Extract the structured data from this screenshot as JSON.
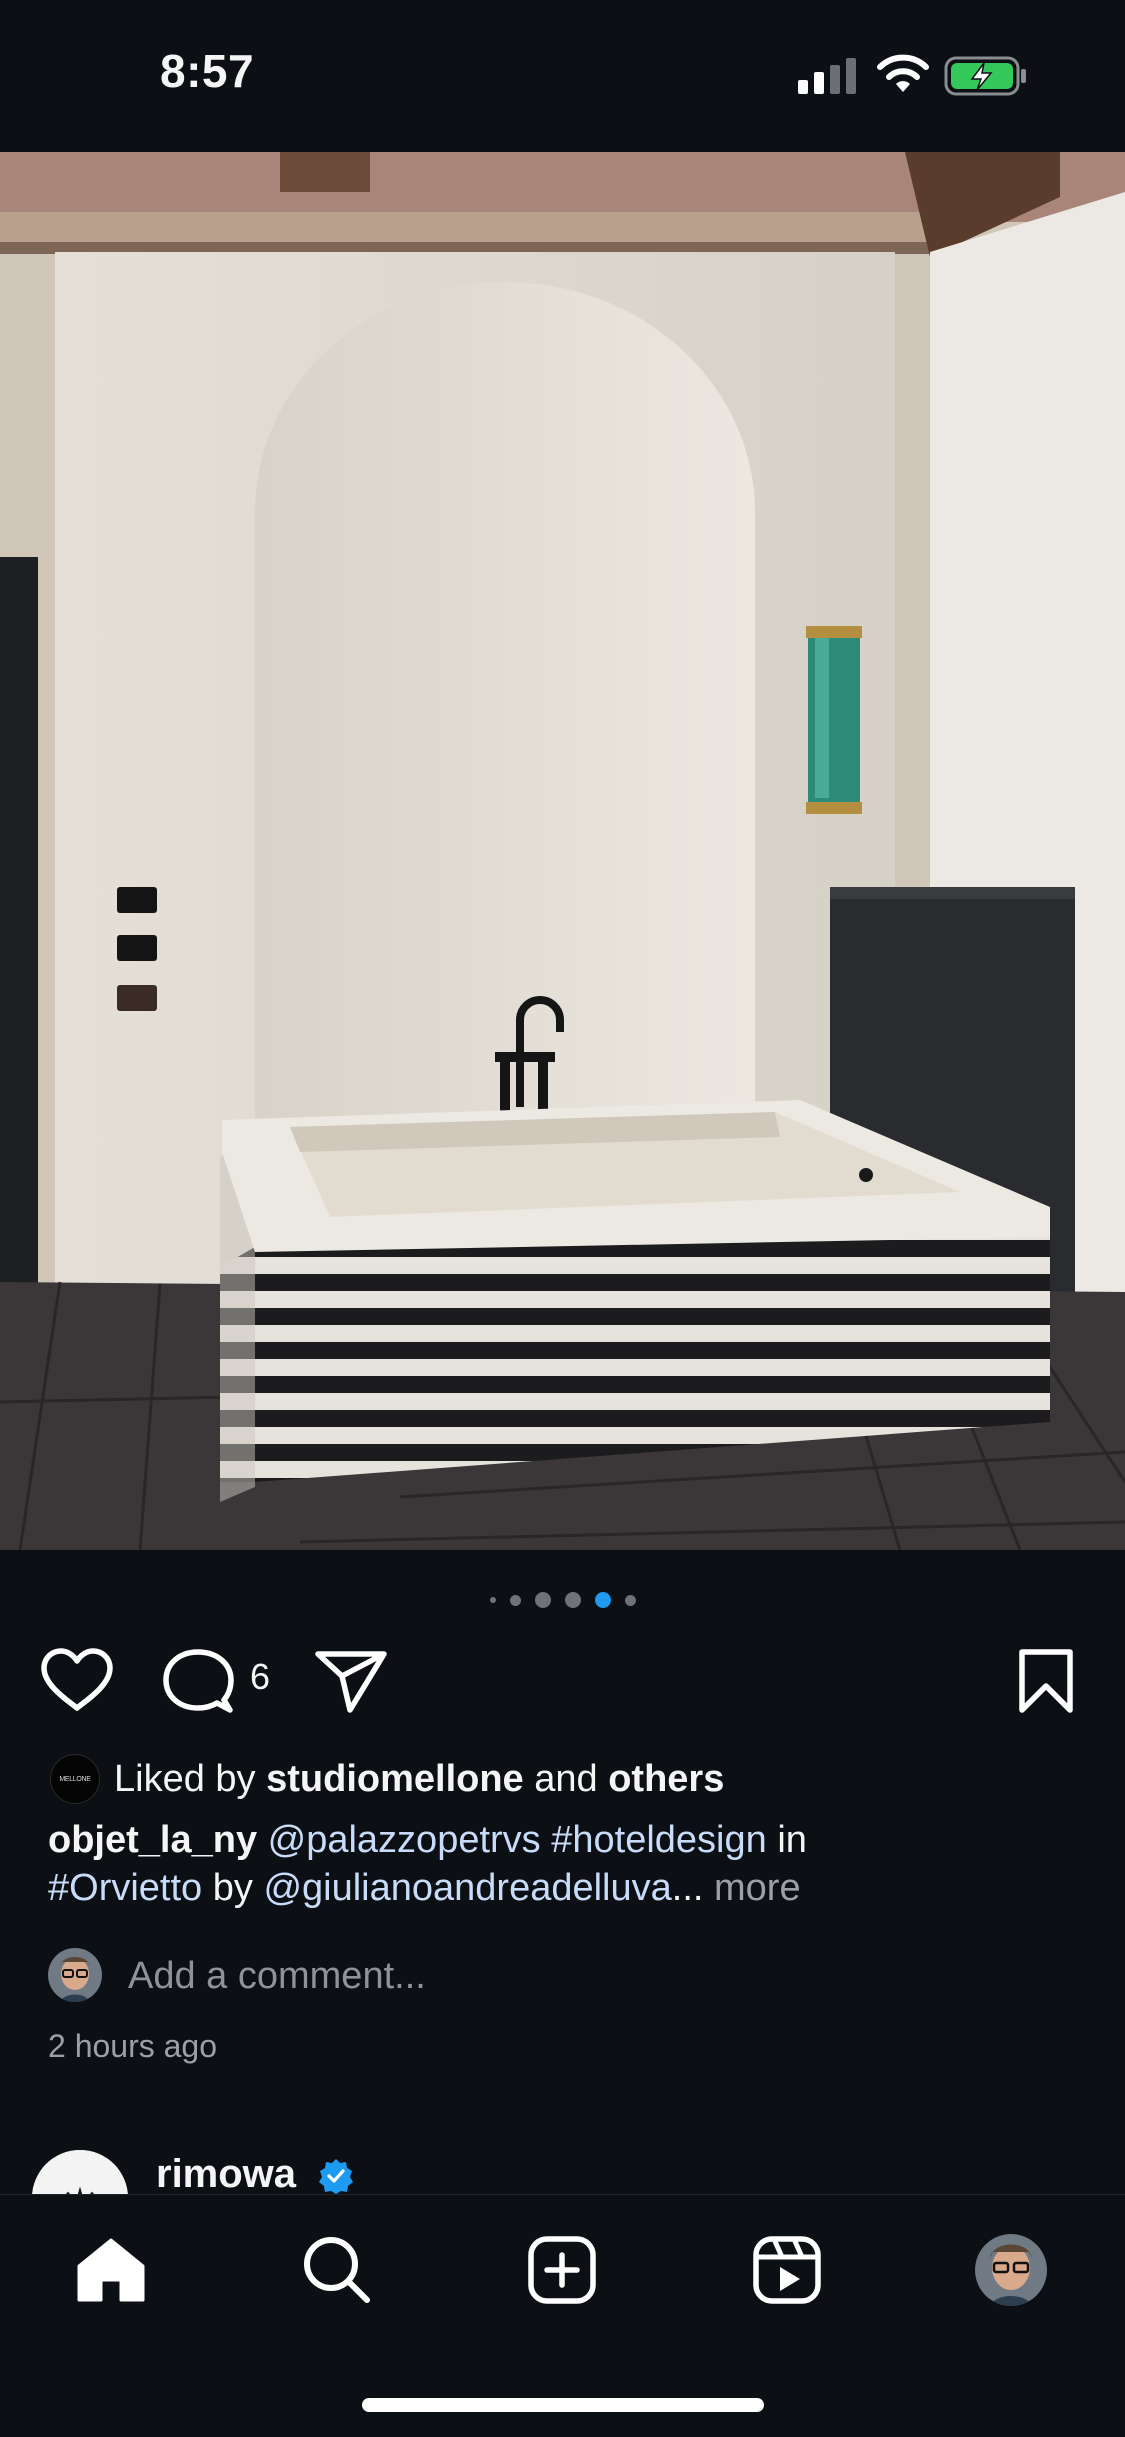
{
  "status_bar": {
    "time": "8:57"
  },
  "post": {
    "carousel": {
      "total": 6,
      "active_index": 4
    },
    "actions": {
      "comment_count": "6"
    },
    "likes": {
      "avatar_text": "MELLONE",
      "prefix": "Liked by",
      "user": "studiomellone",
      "conjunction": "and",
      "others": "others"
    },
    "caption": {
      "username": "objet_la_ny",
      "mention1": "@palazzopetrvs",
      "hashtag1": "#hoteldesign",
      "word_in": "in",
      "hashtag2": "#Orvietto",
      "word_by": "by",
      "mention2": "@giulianoandreadelluva",
      "ellipsis": "...",
      "more": "more"
    },
    "comment_placeholder": "Add a comment...",
    "timestamp": "2 hours ago"
  },
  "next_post": {
    "username": "rimowa"
  },
  "tab_bar": {
    "tabs": [
      "home-icon",
      "search-icon",
      "create-icon",
      "reels-icon",
      "profile-avatar"
    ]
  },
  "colors": {
    "background": "#0c0f14",
    "link": "#c8dcf9",
    "active_dot": "#1d9bf0",
    "battery": "#34c759",
    "verified": "#1d9bf0"
  }
}
